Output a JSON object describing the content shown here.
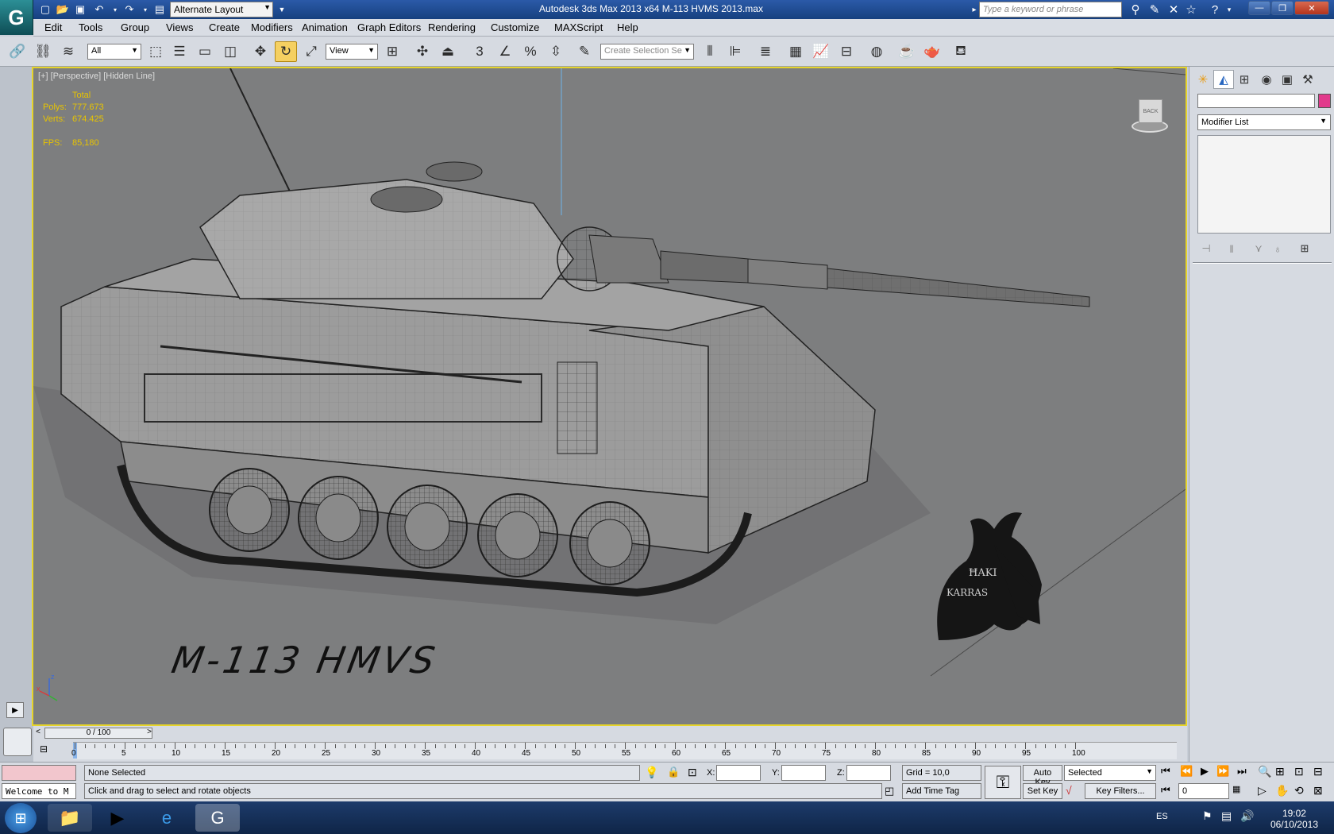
{
  "window": {
    "title": "Autodesk 3ds Max  2013 x64      M-113 HVMS 2013.max",
    "workspace": "Alternate Layout",
    "search_placeholder": "Type a keyword or phrase"
  },
  "menu": [
    "Edit",
    "Tools",
    "Group",
    "Views",
    "Create",
    "Modifiers",
    "Animation",
    "Graph Editors",
    "Rendering",
    "Customize",
    "MAXScript",
    "Help"
  ],
  "toolbar": {
    "selection_filter": "All",
    "ref_coord": "View",
    "named_selection_placeholder": "Create Selection Se"
  },
  "viewport": {
    "label": "[+] [Perspective] [Hidden Line]",
    "stats": {
      "header": "Total",
      "polys_label": "Polys:",
      "polys": "777.673",
      "verts_label": "Verts:",
      "verts": "674.425",
      "fps_label": "FPS:",
      "fps": "85,180"
    },
    "viewcube_label": "BACK",
    "watermark": "M-113  HMVS",
    "logo_text_1": "ĦAKI",
    "logo_text_2": "KARRAS"
  },
  "command_panel": {
    "modifier_list": "Modifier List"
  },
  "timeline": {
    "slider": "0 / 100",
    "ticks": [
      "0",
      "5",
      "10",
      "15",
      "20",
      "25",
      "30",
      "35",
      "40",
      "45",
      "50",
      "55",
      "60",
      "65",
      "70",
      "75",
      "80",
      "85",
      "90",
      "95",
      "100"
    ]
  },
  "status": {
    "maxscript": "Welcome to M",
    "selection": "None Selected",
    "prompt": "Click and drag to select and rotate objects",
    "x_label": "X:",
    "y_label": "Y:",
    "z_label": "Z:",
    "grid": "Grid = 10,0",
    "add_time_tag": "Add Time Tag",
    "auto_key": "Auto Key",
    "set_key": "Set Key",
    "key_mode": "Selected",
    "key_filters": "Key Filters...",
    "frame": "0"
  },
  "taskbar": {
    "lang": "ES",
    "time": "19:02",
    "date": "06/10/2013"
  }
}
